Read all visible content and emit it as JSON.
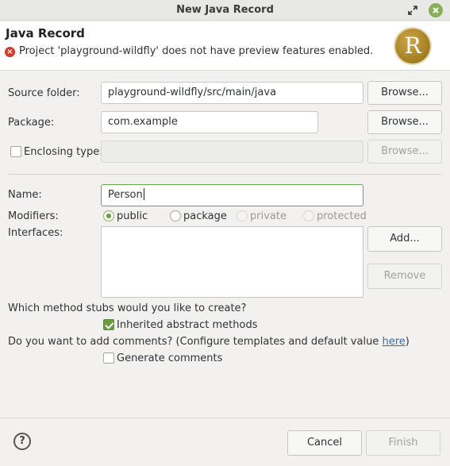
{
  "window": {
    "title": "New Java Record",
    "restore_icon": "restore-icon",
    "close_icon": "close-icon"
  },
  "header": {
    "title": "Java Record",
    "error_message": "Project 'playground-wildfly' does not have preview features enabled.",
    "badge_letter": "R"
  },
  "form": {
    "source_folder": {
      "label": "Source folder:",
      "value": "playground-wildfly/src/main/java",
      "browse": "Browse..."
    },
    "package": {
      "label": "Package:",
      "value": "com.example",
      "browse": "Browse..."
    },
    "enclosing_type": {
      "label": "Enclosing type:",
      "value": "",
      "browse": "Browse...",
      "checked": false
    },
    "name": {
      "label": "Name:",
      "value": "Person"
    },
    "modifiers": {
      "label": "Modifiers:",
      "options": [
        {
          "label": "public",
          "selected": true,
          "enabled": true
        },
        {
          "label": "package",
          "selected": false,
          "enabled": true
        },
        {
          "label": "private",
          "selected": false,
          "enabled": false
        },
        {
          "label": "protected",
          "selected": false,
          "enabled": false
        }
      ]
    },
    "interfaces": {
      "label": "Interfaces:",
      "add": "Add...",
      "remove": "Remove",
      "items": []
    },
    "stubs": {
      "question": "Which method stubs would you like to create?",
      "inherited_label": "Inherited abstract methods",
      "inherited_checked": true
    },
    "comments": {
      "question_prefix": "Do you want to add comments? (Configure templates and default value ",
      "link": "here",
      "question_suffix": ")",
      "generate_label": "Generate comments",
      "generate_checked": false
    }
  },
  "footer": {
    "help_symbol": "?",
    "cancel": "Cancel",
    "finish": "Finish"
  }
}
